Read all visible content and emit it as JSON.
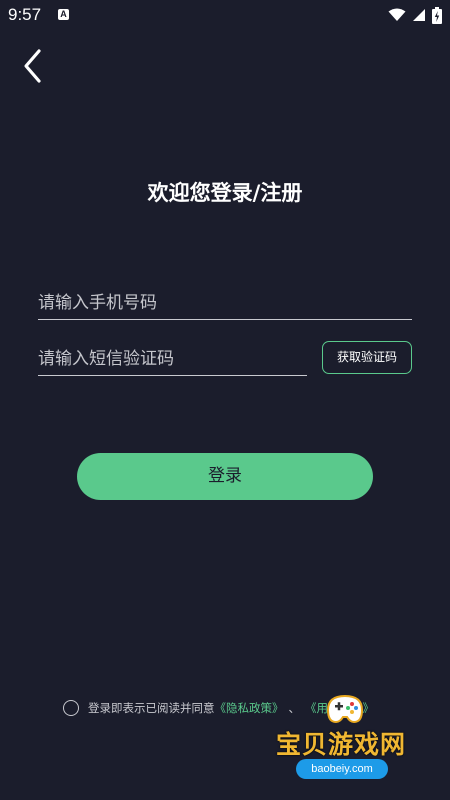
{
  "status_bar": {
    "time": "9:57",
    "notification_icon": "a-icon",
    "wifi_icon": "wifi-icon",
    "signal_icon": "signal-icon",
    "battery_icon": "battery-charging-icon"
  },
  "header": {
    "back_icon": "chevron-left-icon"
  },
  "page": {
    "title": "欢迎您登录/注册"
  },
  "form": {
    "phone_placeholder": "请输入手机号码",
    "code_placeholder": "请输入短信验证码",
    "get_code_label": "获取验证码",
    "login_label": "登录"
  },
  "agreement": {
    "prefix": "登录即表示已阅读并同意",
    "privacy_link": "《隐私政策》",
    "separator": "、",
    "user_link": "《用户协议》"
  },
  "watermark": {
    "brand": "宝贝游戏网",
    "url": "baobeiy.com"
  },
  "colors": {
    "background": "#1b1d2c",
    "accent": "#5ac98c",
    "text": "#ffffff",
    "muted": "#c7c8ce"
  }
}
